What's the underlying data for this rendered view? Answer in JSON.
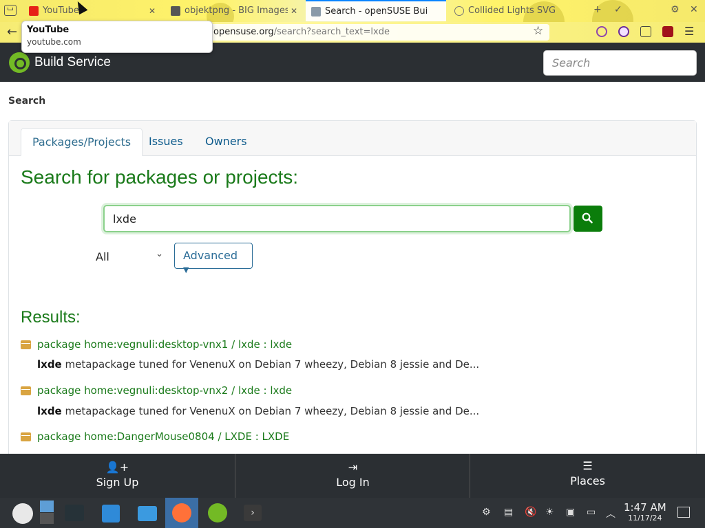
{
  "browser": {
    "tabs": [
      {
        "label": "YouTube"
      },
      {
        "label": "objektpng - BIG Images"
      },
      {
        "label": "Search - openSUSE Build"
      },
      {
        "label": "Collided Lights SVG"
      }
    ],
    "url_host": "opensuse.org",
    "url_path": "/search?search_text=lxde",
    "tooltip_title": "YouTube",
    "tooltip_url": "youtube.com"
  },
  "header": {
    "brand": "Build Service",
    "search_placeholder": "Search"
  },
  "page": {
    "breadcrumb": "Search",
    "tabs": [
      {
        "label": "Packages/Projects"
      },
      {
        "label": "Issues"
      },
      {
        "label": "Owners"
      }
    ],
    "heading": "Search for packages or projects:",
    "search_value": "lxde",
    "scope_selected": "All",
    "advanced_label": "Advanced",
    "results_heading": "Results:",
    "results": [
      {
        "project": "package home:vegnuli:desktop-vnx1",
        "package": "lxde",
        "name": "lxde",
        "desc_bold": "lxde",
        "desc": " metapackage tuned for VenenuX on Debian 7 wheezy, Debian 8 jessie and De..."
      },
      {
        "project": "package home:vegnuli:desktop-vnx2",
        "package": "lxde",
        "name": "lxde",
        "desc_bold": "lxde",
        "desc": " metapackage tuned for VenenuX on Debian 7 wheezy, Debian 8 jessie and De..."
      },
      {
        "project": "package home:DangerMouse0804",
        "package": "LXDE",
        "name": "LXDE",
        "desc_bold": "",
        "desc": ""
      }
    ]
  },
  "bottom_nav": {
    "signup": "Sign Up",
    "login": "Log In",
    "places": "Places"
  },
  "taskbar": {
    "time": "1:47 AM",
    "date": "11/17/24"
  },
  "colors": {
    "green": "#1a7a1a",
    "header_bg": "#2b2f33",
    "link_blue": "#0d5b8c"
  }
}
